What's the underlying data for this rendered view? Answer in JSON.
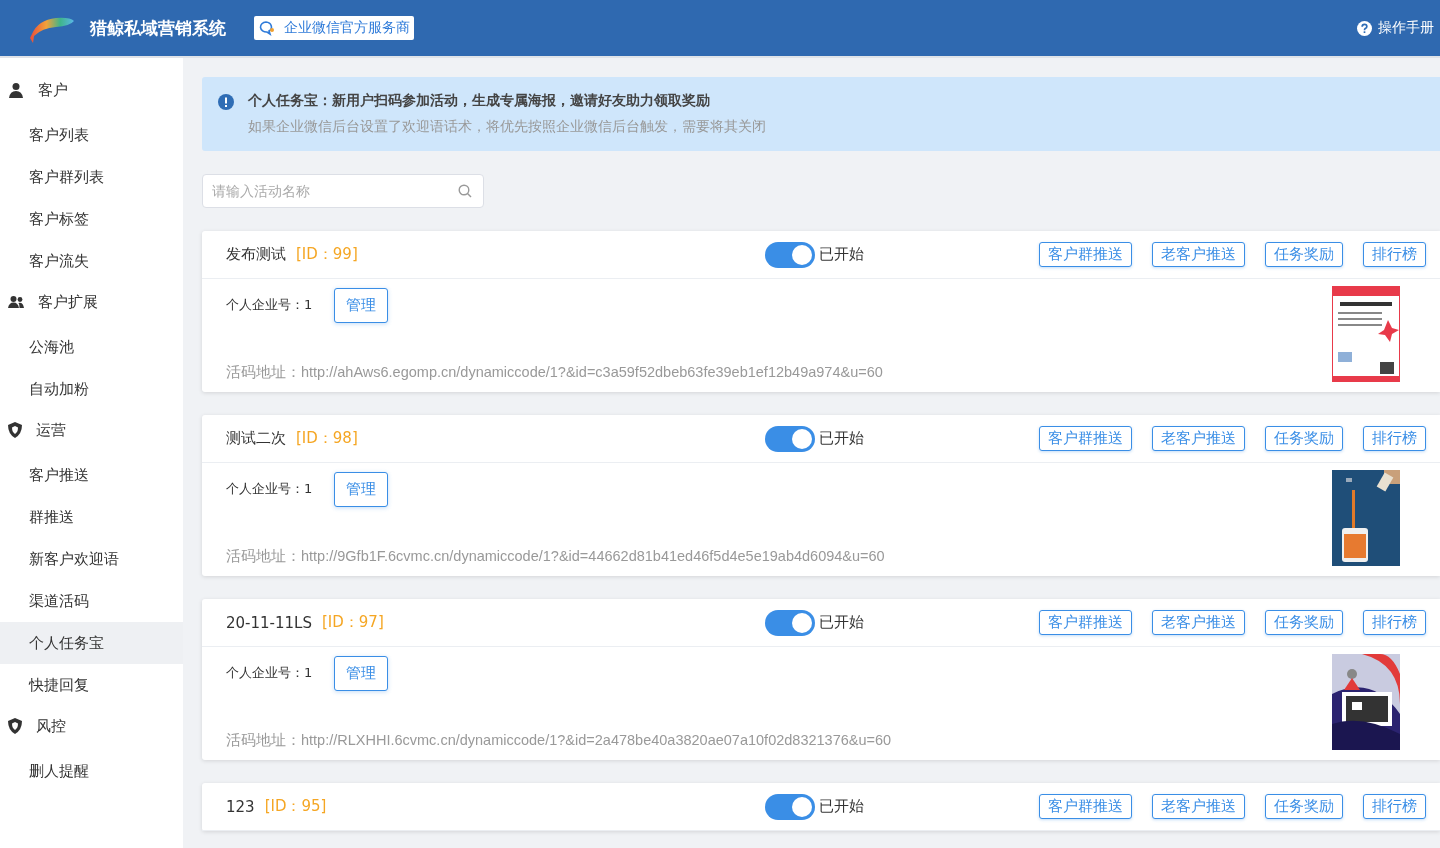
{
  "header": {
    "brand": "猎鲸私域营销系统",
    "partner_badge": "企业微信官方服务商",
    "help_link": "操作手册"
  },
  "sidebar": {
    "groups": [
      {
        "title": "客户",
        "items": [
          {
            "label": "客户列表",
            "selected": false
          },
          {
            "label": "客户群列表",
            "selected": false
          },
          {
            "label": "客户标签",
            "selected": false
          },
          {
            "label": "客户流失",
            "selected": false
          }
        ]
      },
      {
        "title": "客户扩展",
        "items": [
          {
            "label": "公海池",
            "selected": false
          },
          {
            "label": "自动加粉",
            "selected": false
          }
        ]
      },
      {
        "title": "运营",
        "items": [
          {
            "label": "客户推送",
            "selected": false
          },
          {
            "label": "群推送",
            "selected": false
          },
          {
            "label": "新客户欢迎语",
            "selected": false
          },
          {
            "label": "渠道活码",
            "selected": false
          },
          {
            "label": "个人任务宝",
            "selected": true
          },
          {
            "label": "快捷回复",
            "selected": false
          }
        ]
      },
      {
        "title": "风控",
        "items": [
          {
            "label": "删人提醒",
            "selected": false
          }
        ]
      }
    ]
  },
  "notice": {
    "title": "个人任务宝：新用户扫码参加活动，生成专属海报，邀请好友助力领取奖励",
    "description": "如果企业微信后台设置了欢迎语话术，将优先按照企业微信后台触发，需要将其关闭"
  },
  "search": {
    "placeholder": "请输入活动名称"
  },
  "activities": [
    {
      "name": "发布测试",
      "id_tag": "[ID：99]",
      "on": true,
      "status": "已开始",
      "actions": [
        "客户群推送",
        "老客户推送",
        "任务奖励",
        "排行榜"
      ],
      "account_label": "个人企业号：1",
      "manage_button": "管理",
      "link": "活码地址：http://ahAws6.egomp.cn/dynamiccode/1?&id=c3a59f52dbeb63fe39eb1ef12b49a974&u=60"
    },
    {
      "name": "测试二次",
      "id_tag": "[ID：98]",
      "on": true,
      "status": "已开始",
      "actions": [
        "客户群推送",
        "老客户推送",
        "任务奖励",
        "排行榜"
      ],
      "account_label": "个人企业号：1",
      "manage_button": "管理",
      "link": "活码地址：http://9Gfb1F.6cvmc.cn/dynamiccode/1?&id=44662d81b41ed46f5d4e5e19ab4d6094&u=60"
    },
    {
      "name": "20-11-11LS",
      "id_tag": "[ID：97]",
      "on": true,
      "status": "已开始",
      "actions": [
        "客户群推送",
        "老客户推送",
        "任务奖励",
        "排行榜"
      ],
      "account_label": "个人企业号：1",
      "manage_button": "管理",
      "link": "活码地址：http://RLXHHI.6cvmc.cn/dynamiccode/1?&id=2a478be40a3820ae07a10f02d8321376&u=60"
    },
    {
      "name": "123",
      "id_tag": "[ID：95]",
      "on": true,
      "status": "已开始",
      "actions": [
        "客户群推送",
        "老客户推送",
        "任务奖励",
        "排行榜"
      ]
    }
  ]
}
